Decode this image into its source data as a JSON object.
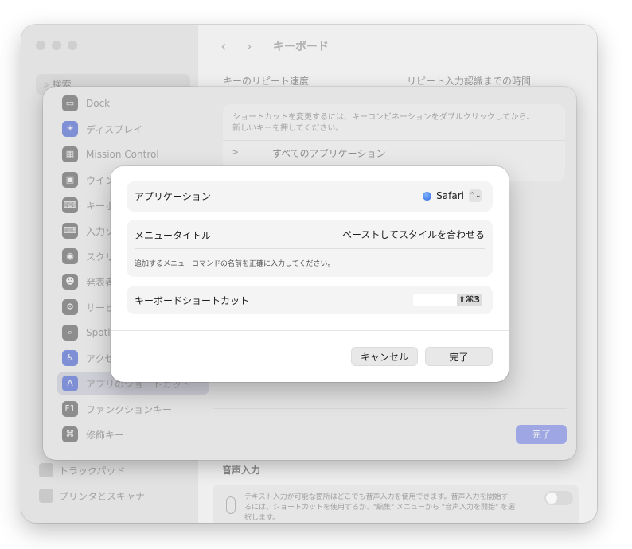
{
  "window": {
    "title": "キーボード",
    "back_glyph": "‹",
    "forward_glyph": "›",
    "search_placeholder": "検索",
    "repeat_speed_label": "キーのリピート速度",
    "repeat_delay_label": "リピート入力認識までの時間",
    "sidebar_bottom": [
      "トラックパッド",
      "プリンタとスキャナ"
    ],
    "voice": {
      "title": "音声入力",
      "description": "テキスト入力が可能な箇所はどこでも音声入力を使用できます。音声入力を開始するには、ショートカットを使用するか、\"編集\" メニューから \"音声入力を開始\" を選択します。"
    }
  },
  "sheet": {
    "note": "ショートカットを変更するには、キーコンビネーションをダブルクリックしてから、新しいキーを押してください。",
    "all_apps_label": "すべてのアプリケーション",
    "chevron": ">",
    "done_label": "完了",
    "items": [
      {
        "label": "Dock",
        "icon": "dock-icon",
        "glyph": "▭"
      },
      {
        "label": "ディスプレイ",
        "icon": "display-icon",
        "glyph": "☀"
      },
      {
        "label": "Mission Control",
        "icon": "mission-control-icon",
        "glyph": "▦"
      },
      {
        "label": "ウインドウ",
        "icon": "window-icon",
        "glyph": "▣"
      },
      {
        "label": "キーボード",
        "icon": "keyboard-icon",
        "glyph": "⌨"
      },
      {
        "label": "入力ソース",
        "icon": "input-source-icon",
        "glyph": "⌨"
      },
      {
        "label": "スクリーンショット",
        "icon": "screenshot-icon",
        "glyph": "◉"
      },
      {
        "label": "発表者オーバーレイ",
        "icon": "presenter-overlay-icon",
        "glyph": "☻"
      },
      {
        "label": "サービス",
        "icon": "services-icon",
        "glyph": "⚙"
      },
      {
        "label": "Spotlight",
        "icon": "spotlight-icon",
        "glyph": "⌕"
      },
      {
        "label": "アクセシビリティ",
        "icon": "accessibility-icon",
        "glyph": "♿"
      },
      {
        "label": "アプリのショートカット",
        "icon": "app-shortcuts-icon",
        "glyph": "A"
      },
      {
        "label": "ファンクションキー",
        "icon": "function-keys-icon",
        "glyph": "F1"
      },
      {
        "label": "修飾キー",
        "icon": "modifier-keys-icon",
        "glyph": "⌘"
      }
    ]
  },
  "dialog": {
    "application_label": "アプリケーション",
    "application_value": "Safari",
    "stepper_glyph": "⌃⌄",
    "menu_title_label": "メニュータイトル",
    "menu_title_value": "ペーストしてスタイルを合わせる",
    "menu_help": "追加するメニューコマンドの名前を正確に入力してください。",
    "shortcut_label": "キーボードショートカット",
    "shortcut_value": "⇧⌘3",
    "cancel_label": "キャンセル",
    "done_label": "完了"
  }
}
